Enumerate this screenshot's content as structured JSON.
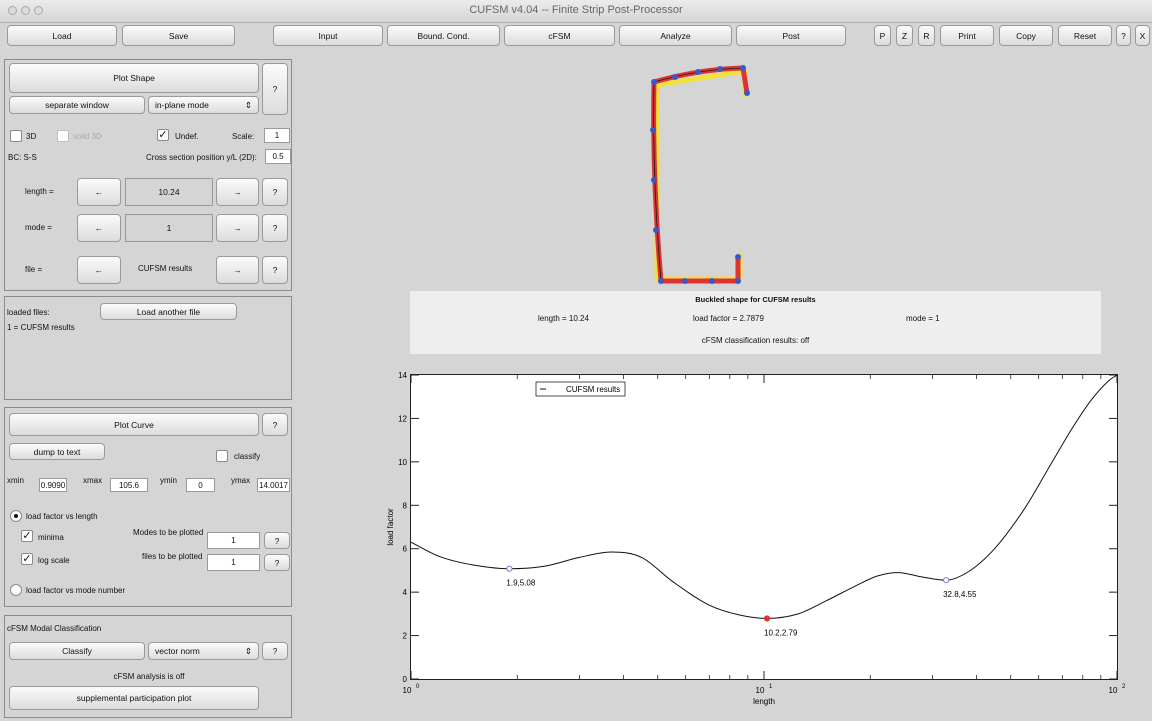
{
  "window": {
    "title": "CUFSM v4.04 -- Finite Strip Post-Processor"
  },
  "toolbar": {
    "load": "Load",
    "save": "Save",
    "input": "Input",
    "bound_cond": "Bound. Cond.",
    "cfsm": "cFSM",
    "analyze": "Analyze",
    "post": "Post",
    "p": "P",
    "z": "Z",
    "r": "R",
    "print": "Print",
    "copy": "Copy",
    "reset": "Reset",
    "help": "?",
    "close": "X"
  },
  "shape_panel": {
    "plot_shape": "Plot Shape",
    "help": "?",
    "separate_window": "separate window",
    "view_mode": "in-plane mode",
    "three_d": "3D",
    "solid_3d": "solid 3D",
    "undef": "Undef.",
    "scale_label": "Scale:",
    "scale_value": "1",
    "bc": "BC: S-S",
    "cross_section_label": "Cross section position y/L (2D):",
    "cross_section_value": "0.5",
    "length_label": "length =",
    "length_value": "10.24",
    "mode_label": "mode =",
    "mode_value": "1",
    "file_label": "file =",
    "file_value": "CUFSM results",
    "prev": "←",
    "next": "→"
  },
  "files_panel": {
    "label": "loaded files:",
    "load_another": "Load another file",
    "entry": "1 = CUFSM results"
  },
  "curve_panel": {
    "plot_curve": "Plot Curve",
    "help": "?",
    "dump": "dump to text",
    "classify": "classify",
    "xmin_label": "xmin",
    "xmin": "0.9090",
    "xmax_label": "xmax",
    "xmax": "105.6",
    "ymin_label": "ymin",
    "ymin": "0",
    "ymax_label": "ymax",
    "ymax": "14.0017",
    "load_vs_length": "load factor vs length",
    "minima": "minima",
    "log_scale": "log scale",
    "modes_label": "Modes to be plotted",
    "modes_value": "1",
    "files_label": "files to be plotted",
    "files_value": "1",
    "load_vs_mode": "load factor vs mode number"
  },
  "cfsm_panel": {
    "title": "cFSM Modal Classification",
    "classify": "Classify",
    "norm": "vector norm",
    "help": "?",
    "status": "cFSM analysis is off",
    "supplemental": "supplemental participation plot"
  },
  "info": {
    "title": "Buckled shape for CUFSM results",
    "length": "length = 10.24",
    "load_factor": "load factor = 2.7879",
    "mode": "mode = 1",
    "classification": "cFSM classification results: off"
  },
  "colors": {
    "highlight_point": "#e53030",
    "min_point": "#7c7cd8",
    "deformed_red": "#dd3333",
    "undeformed_yellow": "#f0e040",
    "node_blue": "#3a57c9"
  },
  "chart_data": {
    "type": "line",
    "x_scale": "log",
    "xlabel": "length",
    "ylabel": "load factor",
    "xlim": [
      1,
      100
    ],
    "ylim": [
      0,
      14
    ],
    "x_ticks": [
      1,
      10,
      100
    ],
    "x_tick_labels": [
      "10",
      "10",
      "10"
    ],
    "x_tick_exponents": [
      "0",
      "1",
      "2"
    ],
    "y_ticks": [
      0,
      2,
      4,
      6,
      8,
      10,
      12,
      14
    ],
    "y_tick_labels": [
      "0",
      "2",
      "4",
      "6",
      "8",
      "10",
      "12",
      "14"
    ],
    "legend": "CUFSM results",
    "legend_position": "top-left",
    "series": [
      {
        "name": "CUFSM results",
        "x": [
          1.0,
          1.2,
          1.5,
          1.9,
          2.4,
          3.0,
          3.7,
          4.5,
          5.5,
          7.0,
          8.5,
          10.2,
          12.5,
          15.0,
          18.0,
          21.0,
          24.0,
          28.0,
          32.8,
          38.0,
          45.0,
          55.0,
          65.0,
          75.0,
          85.0,
          95.0,
          100.0
        ],
        "y": [
          6.3,
          5.65,
          5.25,
          5.08,
          5.2,
          5.6,
          5.85,
          5.6,
          4.5,
          3.4,
          2.95,
          2.79,
          3.0,
          3.6,
          4.25,
          4.75,
          4.9,
          4.7,
          4.55,
          4.95,
          6.0,
          7.9,
          9.9,
          11.6,
          12.9,
          13.75,
          14.0
        ]
      }
    ],
    "annotations": [
      {
        "x": 1.9,
        "y": 5.08,
        "label": "1.9,5.08",
        "color": "#7c7cd8"
      },
      {
        "x": 10.2,
        "y": 2.79,
        "label": "10.2,2.79",
        "color": "#e53030"
      },
      {
        "x": 32.8,
        "y": 4.55,
        "label": "32.8,4.55",
        "color": "#7c7cd8"
      }
    ]
  }
}
